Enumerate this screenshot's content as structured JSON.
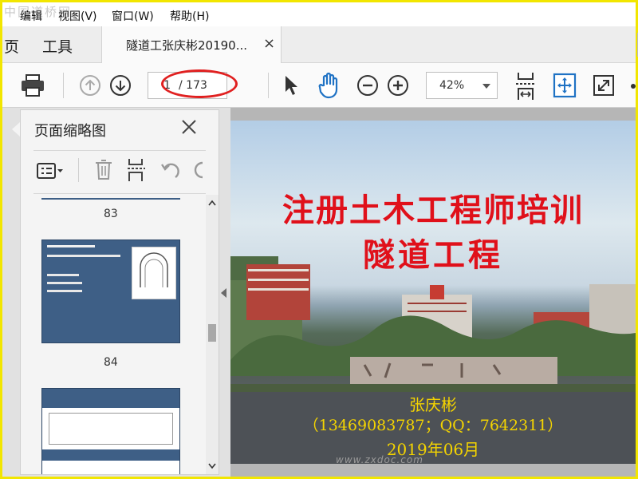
{
  "watermark_top": "中国道桥网",
  "watermark_bottom": "www.zxdoc.com",
  "menu": {
    "items": [
      {
        "label": "编辑"
      },
      {
        "label": "视图(V)"
      },
      {
        "label": "窗口(W)"
      },
      {
        "label": "帮助(H)"
      }
    ]
  },
  "tabs": {
    "home_partial": "页",
    "tools": "工具",
    "document_title": "隧道工张庆彬20190...",
    "close_symbol": "×"
  },
  "toolbar": {
    "current_page": "1",
    "page_total": "/ 173",
    "zoom": "42%"
  },
  "thumbnail_panel": {
    "title": "页面缩略图",
    "thumbnails": [
      {
        "page": "83"
      },
      {
        "page": "84"
      }
    ]
  },
  "slide": {
    "title_line1": "注册土木工程师培训",
    "title_line2": "隧道工程",
    "author": "张庆彬",
    "contact": "（13469083787；QQ：7642311）",
    "date": "2019年06月"
  },
  "colors": {
    "window_border": "#f2e600",
    "slide_title": "#e0101a",
    "slide_text": "#f4d400",
    "accent_blue": "#1f72c4",
    "annotation_red": "#e02020"
  },
  "icons": [
    "print-icon",
    "page-up-icon",
    "page-down-icon",
    "select-cursor-icon",
    "hand-icon",
    "zoom-out-icon",
    "zoom-in-icon",
    "fit-page-icon",
    "scroll-mode-icon",
    "fullscreen-icon",
    "options-icon",
    "delete-icon",
    "undo-icon",
    "redo-icon"
  ]
}
